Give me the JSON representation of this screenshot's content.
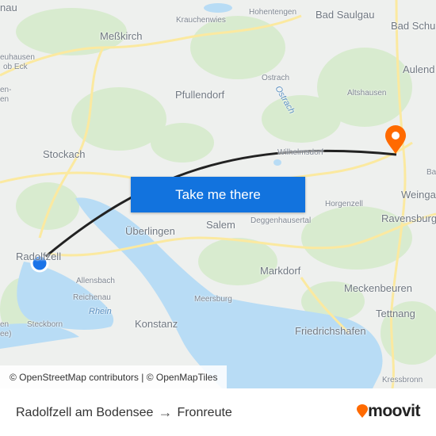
{
  "map": {
    "labels": [
      {
        "text": "nau",
        "cls": "big"
      },
      {
        "text": "Meßkirch",
        "cls": "big"
      },
      {
        "text": "Krauchenwies",
        "cls": ""
      },
      {
        "text": "Hohentengen",
        "cls": ""
      },
      {
        "text": "Bad Saulgau",
        "cls": "big"
      },
      {
        "text": "Bad Schu",
        "cls": "big"
      },
      {
        "text": "euhausen",
        "cls": ""
      },
      {
        "text": "ob Eck",
        "cls": ""
      },
      {
        "text": "Aulend",
        "cls": "big"
      },
      {
        "text": "Ostrach",
        "cls": ""
      },
      {
        "text": "Pfullendorf",
        "cls": "big"
      },
      {
        "text": "Altshausen",
        "cls": ""
      },
      {
        "text": "en-",
        "cls": ""
      },
      {
        "text": "en",
        "cls": ""
      },
      {
        "text": "Ostrach",
        "cls": "water"
      },
      {
        "text": "Stockach",
        "cls": "big"
      },
      {
        "text": "Wilhelmsdorf",
        "cls": ""
      },
      {
        "text": "Ba",
        "cls": ""
      },
      {
        "text": "Weinga",
        "cls": "big"
      },
      {
        "text": "Horgenzell",
        "cls": ""
      },
      {
        "text": "Ravensburg",
        "cls": "big"
      },
      {
        "text": "Überlingen",
        "cls": "big"
      },
      {
        "text": "Salem",
        "cls": "big"
      },
      {
        "text": "Deggenhausertal",
        "cls": ""
      },
      {
        "text": "Radolfzell",
        "cls": "big"
      },
      {
        "text": "Markdorf",
        "cls": "big"
      },
      {
        "text": "Allensbach",
        "cls": ""
      },
      {
        "text": "Meckenbeuren",
        "cls": "big"
      },
      {
        "text": "Reichenau",
        "cls": ""
      },
      {
        "text": "Meersburg",
        "cls": ""
      },
      {
        "text": "Rhein",
        "cls": "water"
      },
      {
        "text": "Tettnang",
        "cls": "big"
      },
      {
        "text": "Steckborn",
        "cls": ""
      },
      {
        "text": "Konstanz",
        "cls": "big"
      },
      {
        "text": "Friedrichshafen",
        "cls": "big"
      },
      {
        "text": "Kressbronn",
        "cls": ""
      },
      {
        "text": "en",
        "cls": ""
      },
      {
        "text": "ee)",
        "cls": ""
      }
    ],
    "cta_label": "Take me there",
    "attribution": "© OpenStreetMap contributors | © OpenMapTiles",
    "colors": {
      "route": "#222222",
      "origin": "#1a73e8",
      "destination": "#ff6a00",
      "water": "#b8dcf5",
      "forest": "#d8ebcf",
      "road": "#fbe9a0",
      "button": "#1273de"
    }
  },
  "footer": {
    "origin": "Radolfzell am Bodensee",
    "arrow": "→",
    "destination": "Fronreute",
    "logo": "moovit"
  }
}
